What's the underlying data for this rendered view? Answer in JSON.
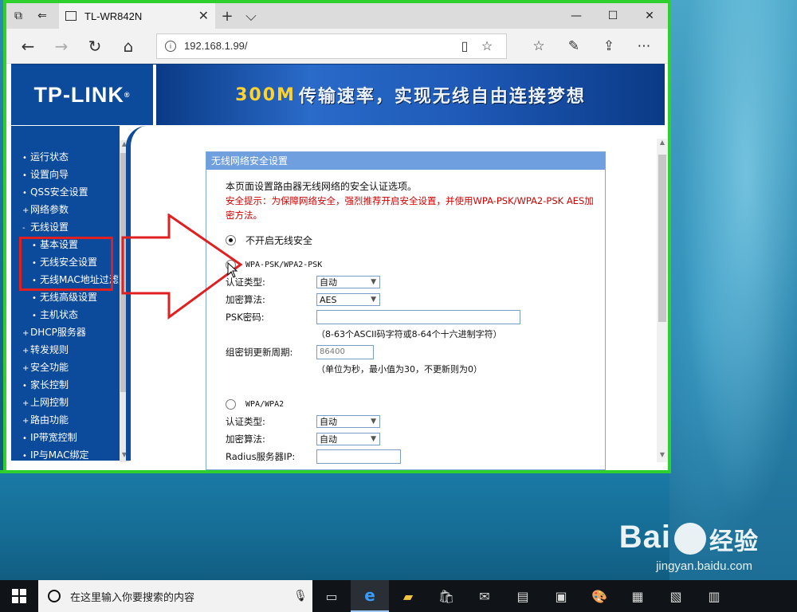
{
  "browser": {
    "tab_title": "TL-WR842N",
    "address": "192.168.1.99/",
    "icons": [
      "tab-set-aside-icon",
      "back-tabs-icon",
      "close-icon",
      "new-tab-icon",
      "chevron-down-icon",
      "minimize-icon",
      "maximize-icon",
      "window-close-icon",
      "back-icon",
      "forward-icon",
      "refresh-icon",
      "home-icon",
      "reading-view-icon",
      "favorite-icon",
      "favorites-hub-icon",
      "notes-icon",
      "share-icon",
      "more-icon"
    ]
  },
  "banner": {
    "logo": "TP-LINK",
    "slogan_highlight": "300M",
    "slogan_text": "传输速率，实现无线自由连接梦想"
  },
  "sidebar": {
    "items": [
      {
        "marker": "•",
        "label": "运行状态"
      },
      {
        "marker": "•",
        "label": "设置向导"
      },
      {
        "marker": "•",
        "label": "QSS安全设置"
      },
      {
        "marker": "+",
        "label": "网络参数"
      },
      {
        "marker": "-",
        "label": "无线设置"
      },
      {
        "marker": "•",
        "label": "基本设置",
        "sub": true
      },
      {
        "marker": "•",
        "label": "无线安全设置",
        "sub": true
      },
      {
        "marker": "•",
        "label": "无线MAC地址过滤",
        "sub": true
      },
      {
        "marker": "•",
        "label": "无线高级设置",
        "sub": true
      },
      {
        "marker": "•",
        "label": "主机状态",
        "sub": true
      },
      {
        "marker": "+",
        "label": "DHCP服务器"
      },
      {
        "marker": "+",
        "label": "转发规则"
      },
      {
        "marker": "+",
        "label": "安全功能"
      },
      {
        "marker": "•",
        "label": "家长控制"
      },
      {
        "marker": "+",
        "label": "上网控制"
      },
      {
        "marker": "+",
        "label": "路由功能"
      },
      {
        "marker": "•",
        "label": "IP带宽控制"
      },
      {
        "marker": "•",
        "label": "IP与MAC绑定"
      }
    ]
  },
  "panel": {
    "title": "无线网络安全设置",
    "description": "本页面设置路由器无线网络的安全认证选项。",
    "tip": "安全提示：为保障网络安全，强烈推荐开启安全设置，并使用WPA-PSK/WPA2-PSK AES加密方法。",
    "option_none": "不开启无线安全",
    "option_psk": "WPA-PSK/WPA2-PSK",
    "psk": {
      "auth_label": "认证类型:",
      "auth_value": "自动",
      "enc_label": "加密算法:",
      "enc_value": "AES",
      "pwd_label": "PSK密码:",
      "pwd_hint": "（8-63个ASCII码字符或8-64个十六进制字符）",
      "renew_label": "组密钥更新周期:",
      "renew_value": "86400",
      "renew_hint": "（单位为秒，最小值为30，不更新则为0）"
    },
    "option_wpa": "WPA/WPA2",
    "wpa": {
      "auth_label": "认证类型:",
      "auth_value": "自动",
      "enc_label": "加密算法:",
      "enc_value": "自动",
      "radius_label": "Radius服务器IP:"
    }
  },
  "taskbar": {
    "search_placeholder": "在这里输入你要搜索的内容"
  },
  "watermark": {
    "brand_left": "Bai",
    "brand_right": "经验",
    "url": "jingyan.baidu.com"
  },
  "colors": {
    "tp_blue": "#0c4a9c",
    "window_border": "#2ed02e",
    "annotation_red": "#e02020",
    "tip_red": "#d00000"
  }
}
